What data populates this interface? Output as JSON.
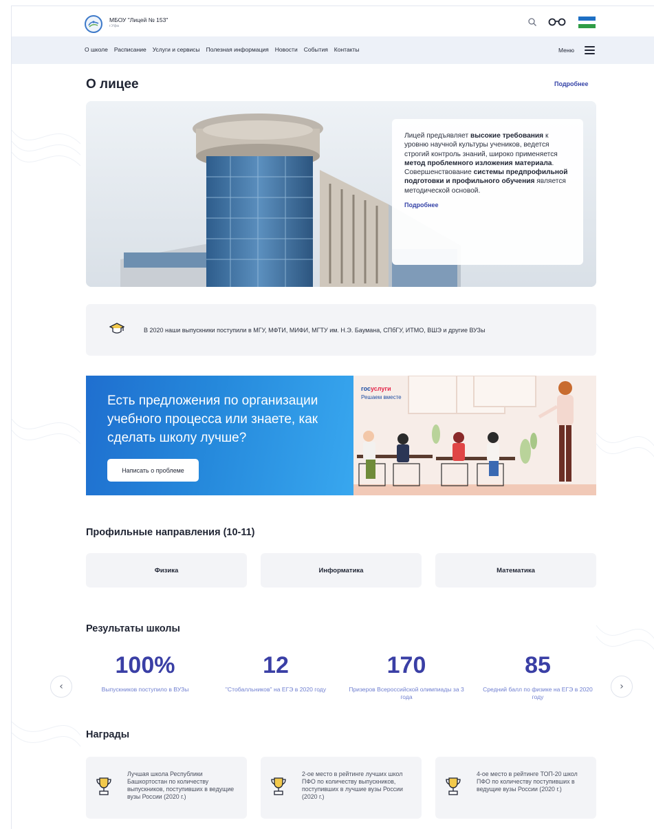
{
  "header": {
    "school_name": "МБОУ \"Лицей № 153\"",
    "city": "г.Уфа",
    "icons": [
      "logo-emblem-icon",
      "search-icon",
      "glasses-icon",
      "bashkortostan-flag-icon"
    ],
    "flag_colors": [
      "#1e6fc4",
      "#ffffff",
      "#2f9c46"
    ]
  },
  "nav": {
    "items": [
      "О школе",
      "Расписание",
      "Услуги и сервисы",
      "Полезная информация",
      "Новости",
      "События",
      "Контакты"
    ],
    "menu_label": "Меню"
  },
  "about": {
    "title": "О лицее",
    "more_link": "Подробнее",
    "card_parts": [
      "Лицей предъявляет ",
      "высокие требования",
      " к уровню научной культуры учеников, ведется строгий контроль знаний, широко применяется ",
      "метод проблемного изложения материала",
      ". Совершенствование ",
      "системы предпрофильной подготовки и профильного обучения",
      " является методической основой."
    ],
    "card_link": "Подробнее"
  },
  "graduates": {
    "icon": "graduation-cap-icon",
    "text": "В 2020 наши выпускники поступили в МГУ, МФТИ, МИФИ, МГТУ им. Н.Э. Баумана, СПбГУ, ИТМО, ВШЭ и другие ВУЗы"
  },
  "banner": {
    "title": "Есть предложения по организации учебного процесса или знаете, как сделать школу лучше?",
    "button": "Написать о проблеме",
    "gos_part1": "гос",
    "gos_part2": "услуги",
    "gos_sub": "Решаем вместе",
    "accent": "#2588db"
  },
  "profiles": {
    "title": "Профильные направления (10-11)",
    "items": [
      "Физика",
      "Информатика",
      "Математика"
    ]
  },
  "results": {
    "title": "Результаты школы",
    "stats": [
      {
        "value": "100%",
        "label": "Выпускников поступило в ВУЗы"
      },
      {
        "value": "12",
        "label": "\"Стобалльников\" на ЕГЭ в 2020 году"
      },
      {
        "value": "170",
        "label": "Призеров Всероссийской олимпиады за 3 года"
      },
      {
        "value": "85",
        "label": "Средний балл по физике на ЕГЭ в 2020 году"
      }
    ],
    "prev_icon": "chevron-left-icon",
    "next_icon": "chevron-right-icon",
    "accent": "#3a3fa5"
  },
  "awards": {
    "title": "Награды",
    "items": [
      "Лучшая школа Республики Башкортостан по количеству выпускников, поступивших в ведущие вузы России (2020 г.)",
      "2-ое место в рейтинге лучших школ ПФО по количеству выпускников, поступивших в лучшие вузы России (2020 г.)",
      "4-ое место в рейтинге ТОП-20 школ ПФО по количеству поступивших в ведущие вузы России (2020 г.)"
    ],
    "icon": "trophy-icon"
  }
}
